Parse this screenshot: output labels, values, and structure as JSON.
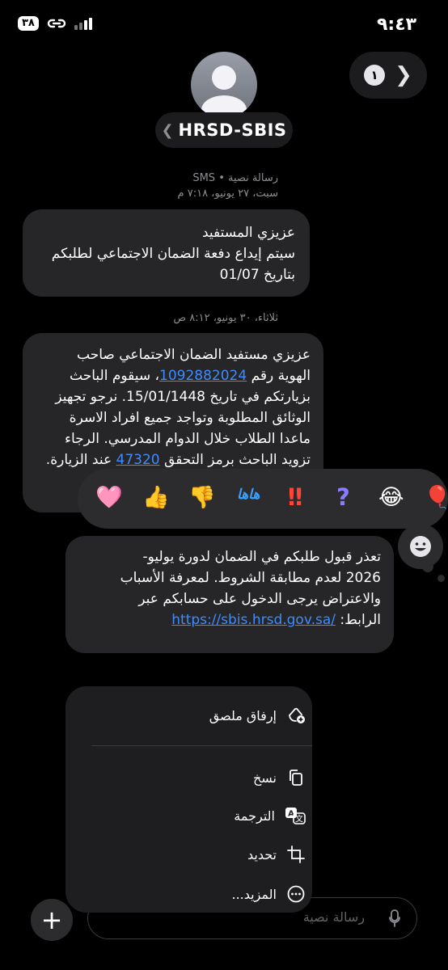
{
  "status_bar": {
    "time": "٩:٤٣",
    "battery": "٣٨"
  },
  "header": {
    "contact_name": "HRSD-SBIS",
    "contact_chevron": "❮",
    "unread_count": "١",
    "nav_chevron": "❯"
  },
  "thread": {
    "meta_type": "رسالة نصية • SMS",
    "meta_date_1": "سبت، ٢٧ يونيو، ٧:١٨ م",
    "msg1": {
      "line1": "عزيزي المستفيد",
      "line2": "سيتم إيداع دفعة الضمان الاجتماعي لطلبكم",
      "line3": "بتاريخ  01/07"
    },
    "meta_date_2": "ثلاثاء، ٣٠ يونيو، ٨:١٢ ص",
    "msg2": {
      "l1": "عزيزي مستفيد الضمان الاجتماعي صاحب",
      "l2_a": "الهوية رقم ",
      "l2_link": "1092882024",
      "l2_b": "، سيقوم الباحث",
      "l3": "بزيارتكم في تاريخ 15/01/1448. نرجو تجهيز",
      "l4": "الوثائق المطلوبة وتواجد جميع افراد الاسرة",
      "l5": "ماعدا الطلاب خلال الدوام المدرسي. الرجاء",
      "l6_a": "تزويد الباحث برمز التحقق ",
      "l6_link": "47320",
      "l6_b": " عند الزيارة."
    },
    "msg3": {
      "l1": "تعذر قبول طلبكم في الضمان لدورة يوليو-",
      "l2": "2026  لعدم مطابقة الشروط. لمعرفة الأسباب",
      "l3": "والاعتراض يرجى الدخول على حسابكم عبر",
      "l4_a": "الرابط: ",
      "l4_link": "https://sbis.hrsd.gov.sa/"
    }
  },
  "tapbacks": {
    "heart": "🩷",
    "thumbs_up": "👍",
    "thumbs_down": "👎",
    "haha": "هاها",
    "exclaim": "‼",
    "question": "?",
    "laugh": "😂",
    "balloon": "🎈"
  },
  "context_menu": {
    "attach_sticker": "إرفاق ملصق",
    "copy": "نسخ",
    "translate": "الترجمة",
    "select": "تحديد",
    "more": "المزيد..."
  },
  "composer": {
    "plus": "+",
    "placeholder": "رسالة نصية"
  }
}
